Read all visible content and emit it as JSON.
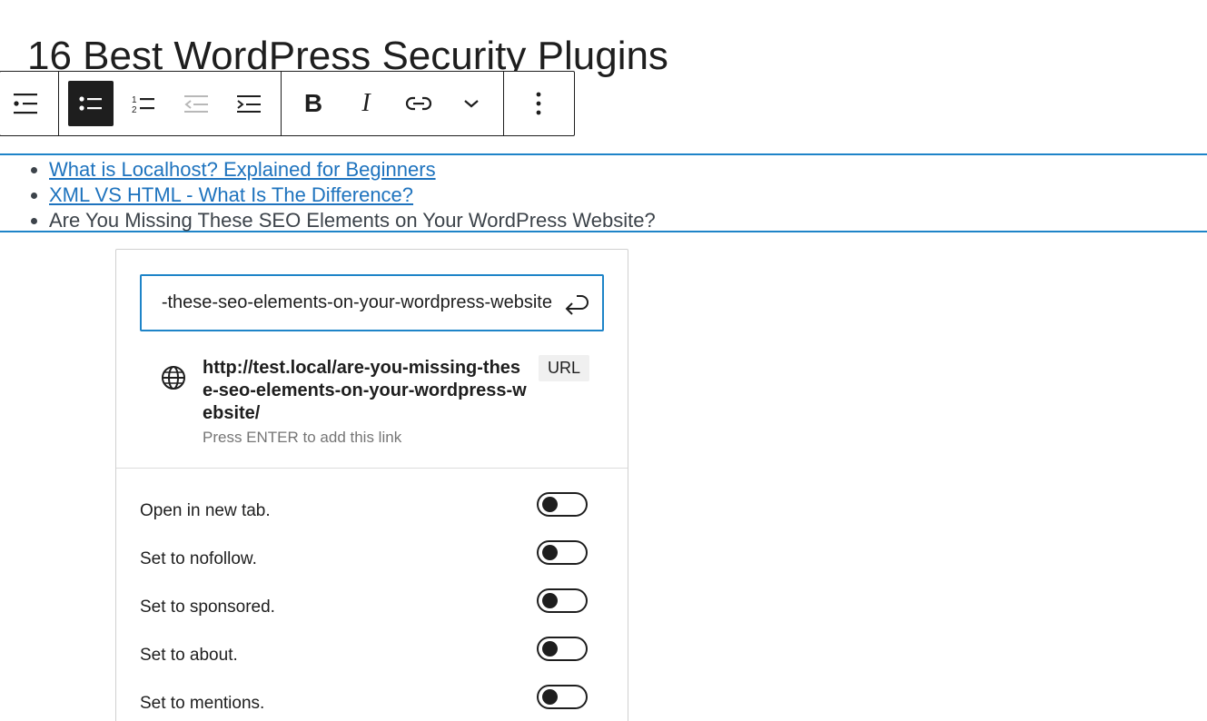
{
  "post": {
    "title": "16 Best WordPress Security Plugins"
  },
  "toolbar": {
    "groups": [
      {
        "items": [
          {
            "icon": "list-block-icon",
            "label": "List"
          }
        ]
      },
      {
        "items": [
          {
            "icon": "unordered-list-icon",
            "label": "Unordered",
            "active": true
          },
          {
            "icon": "ordered-list-icon",
            "label": "Ordered"
          },
          {
            "icon": "outdent-icon",
            "label": "Outdent",
            "disabled": true
          },
          {
            "icon": "indent-icon",
            "label": "Indent"
          }
        ]
      },
      {
        "items": [
          {
            "icon": "bold-icon",
            "glyph": "B"
          },
          {
            "icon": "italic-icon",
            "glyph": "I"
          },
          {
            "icon": "link-icon",
            "label": "Link"
          },
          {
            "icon": "chevron-down-icon",
            "label": "More"
          }
        ]
      },
      {
        "items": [
          {
            "icon": "more-options-icon",
            "label": "Options"
          }
        ]
      }
    ],
    "bold_glyph": "B",
    "italic_glyph": "I"
  },
  "list": {
    "items": [
      {
        "text": "What is Localhost? Explained for Beginners",
        "link": true
      },
      {
        "text": "XML VS HTML - What Is The Difference?",
        "link": true
      },
      {
        "text": "Are You Missing These SEO Elements on Your WordPress Website?",
        "link": false
      }
    ]
  },
  "link_popover": {
    "input_value": "http://test.local/are-you-missing-these-seo-elements-on-your-wordpress-website/",
    "suggestion": {
      "title": "http://test.local/are-you-missing-these-seo-elements-on-your-wordpress-website/",
      "badge": "URL",
      "hint": "Press ENTER to add this link"
    },
    "settings": [
      {
        "label": "Open in new tab.",
        "checked": false
      },
      {
        "label": "Set to nofollow.",
        "checked": false
      },
      {
        "label": "Set to sponsored.",
        "checked": false
      },
      {
        "label": "Set to about.",
        "checked": false
      },
      {
        "label": "Set to mentions.",
        "checked": false
      }
    ]
  },
  "colors": {
    "accent": "#1e84c8",
    "link": "#1e73be",
    "text": "#1e1e1e"
  }
}
